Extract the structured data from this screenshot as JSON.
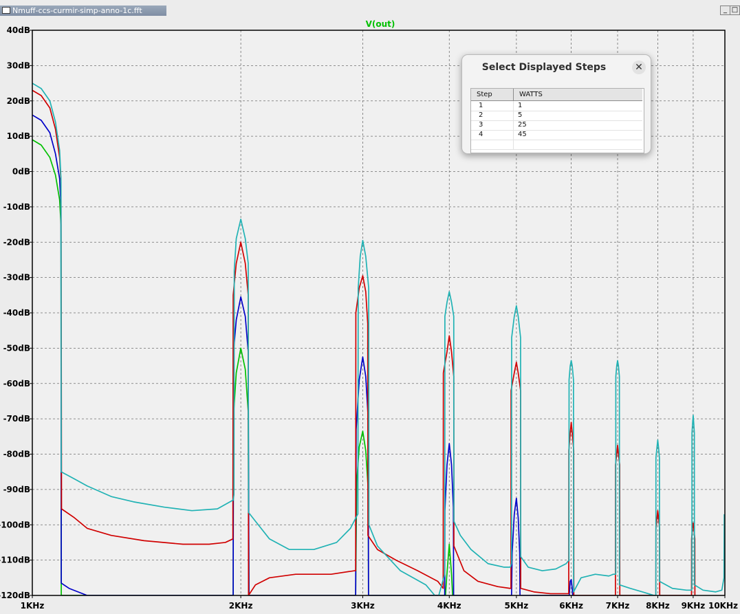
{
  "window": {
    "title": "Nmuff-ccs-curmir-simp-anno-1c.fft",
    "minimize_label": "_",
    "maximize_label": "□"
  },
  "colors": {
    "background": "#f0f0f0",
    "grid": "#6e6e6e",
    "frame": "#000000",
    "trace_title": "#00c000"
  },
  "chart_data": {
    "type": "line",
    "title": "V(out)",
    "x_scale": "log",
    "xlim": [
      1000,
      10000
    ],
    "ylim": [
      -120,
      40
    ],
    "grid": true,
    "y_ticks": [
      40,
      30,
      20,
      10,
      0,
      -10,
      -20,
      -30,
      -40,
      -50,
      -60,
      -70,
      -80,
      -90,
      -100,
      -110,
      -120
    ],
    "y_tick_labels": [
      "40dB",
      "30dB",
      "20dB",
      "10dB",
      "0dB",
      "-10dB",
      "-20dB",
      "-30dB",
      "-40dB",
      "-50dB",
      "-60dB",
      "-70dB",
      "-80dB",
      "-90dB",
      "-100dB",
      "-110dB",
      "-120dB"
    ],
    "x_ticks": [
      1000,
      2000,
      3000,
      4000,
      5000,
      6000,
      7000,
      8000,
      9000,
      10000
    ],
    "x_tick_labels": [
      "1KHz",
      "2KHz",
      "3KHz",
      "4KHz",
      "5KHz",
      "6KHz",
      "7KHz",
      "8KHz",
      "9KHz",
      "10KHz"
    ],
    "series": [
      {
        "color": "#00c000",
        "points": [
          [
            1000,
            9
          ],
          [
            1030,
            7.5
          ],
          [
            1060,
            4
          ],
          [
            1080,
            -1
          ],
          [
            1095,
            -8
          ],
          [
            1100,
            -15
          ],
          [
            1101,
            -120
          ],
          [
            1950,
            -120
          ],
          [
            1952,
            -69
          ],
          [
            1970,
            -57
          ],
          [
            2000,
            -50
          ],
          [
            2030,
            -56
          ],
          [
            2050,
            -68
          ],
          [
            2055,
            -120
          ],
          [
            2930,
            -120
          ],
          [
            2940,
            -88
          ],
          [
            2965,
            -78
          ],
          [
            3000,
            -73.5
          ],
          [
            3030,
            -79
          ],
          [
            3055,
            -90
          ],
          [
            3058,
            -120
          ],
          [
            3950,
            -120
          ],
          [
            3965,
            -115
          ],
          [
            4000,
            -105.5
          ],
          [
            4030,
            -114
          ],
          [
            4045,
            -120
          ]
        ]
      },
      {
        "color": "#0000c8",
        "points": [
          [
            1000,
            16
          ],
          [
            1030,
            14.5
          ],
          [
            1060,
            11
          ],
          [
            1080,
            5
          ],
          [
            1095,
            -2
          ],
          [
            1100,
            -10
          ],
          [
            1101,
            -116.5
          ],
          [
            1130,
            -118
          ],
          [
            1200,
            -120
          ],
          [
            1950,
            -120
          ],
          [
            1952,
            -51
          ],
          [
            1970,
            -42
          ],
          [
            2000,
            -35.5
          ],
          [
            2030,
            -41
          ],
          [
            2050,
            -51
          ],
          [
            2055,
            -120
          ],
          [
            2930,
            -120
          ],
          [
            2935,
            -73
          ],
          [
            2965,
            -59
          ],
          [
            3000,
            -52.5
          ],
          [
            3030,
            -58
          ],
          [
            3055,
            -70
          ],
          [
            3058,
            -120
          ],
          [
            3940,
            -120
          ],
          [
            3942,
            -96
          ],
          [
            3970,
            -83
          ],
          [
            4000,
            -77
          ],
          [
            4030,
            -83
          ],
          [
            4055,
            -95
          ],
          [
            4058,
            -120
          ],
          [
            4920,
            -120
          ],
          [
            4930,
            -108
          ],
          [
            4965,
            -97
          ],
          [
            5000,
            -92.5
          ],
          [
            5030,
            -98
          ],
          [
            5055,
            -108
          ],
          [
            5060,
            -120
          ],
          [
            5960,
            -120
          ],
          [
            5980,
            -116
          ],
          [
            6000,
            -115.5
          ],
          [
            6020,
            -118
          ],
          [
            6030,
            -120
          ]
        ]
      },
      {
        "color": "#d00000",
        "points": [
          [
            1000,
            23
          ],
          [
            1030,
            21.5
          ],
          [
            1060,
            18
          ],
          [
            1080,
            12
          ],
          [
            1095,
            4
          ],
          [
            1100,
            -3
          ],
          [
            1101,
            -43
          ],
          [
            1102,
            -95.5
          ],
          [
            1150,
            -98
          ],
          [
            1200,
            -101
          ],
          [
            1300,
            -103
          ],
          [
            1450,
            -104.5
          ],
          [
            1650,
            -105.5
          ],
          [
            1800,
            -105.5
          ],
          [
            1900,
            -105
          ],
          [
            1948,
            -104
          ],
          [
            1950,
            -35
          ],
          [
            1970,
            -26
          ],
          [
            2000,
            -20
          ],
          [
            2030,
            -26
          ],
          [
            2050,
            -35
          ],
          [
            2052,
            -120
          ],
          [
            2100,
            -117
          ],
          [
            2200,
            -115
          ],
          [
            2400,
            -114
          ],
          [
            2700,
            -114
          ],
          [
            2920,
            -113
          ],
          [
            2930,
            -113
          ],
          [
            2932,
            -40
          ],
          [
            2965,
            -33
          ],
          [
            3000,
            -29.5
          ],
          [
            3030,
            -34
          ],
          [
            3050,
            -43
          ],
          [
            3052,
            -103
          ],
          [
            3150,
            -107
          ],
          [
            3350,
            -110
          ],
          [
            3600,
            -113
          ],
          [
            3850,
            -116
          ],
          [
            3920,
            -118
          ],
          [
            3922,
            -57
          ],
          [
            3970,
            -51
          ],
          [
            4000,
            -46.5
          ],
          [
            4030,
            -51
          ],
          [
            4060,
            -58
          ],
          [
            4062,
            -106
          ],
          [
            4200,
            -113
          ],
          [
            4400,
            -116
          ],
          [
            4700,
            -117.5
          ],
          [
            4900,
            -118
          ],
          [
            4910,
            -118
          ],
          [
            4912,
            -62
          ],
          [
            4965,
            -57
          ],
          [
            5000,
            -54
          ],
          [
            5030,
            -57
          ],
          [
            5070,
            -62
          ],
          [
            5072,
            -118
          ],
          [
            5300,
            -119
          ],
          [
            5600,
            -119.5
          ],
          [
            5900,
            -119.5
          ],
          [
            5950,
            -119.5
          ],
          [
            5952,
            -79
          ],
          [
            5980,
            -74
          ],
          [
            6000,
            -71
          ],
          [
            6020,
            -74
          ],
          [
            6050,
            -79
          ],
          [
            6052,
            -120
          ],
          [
            6950,
            -120
          ],
          [
            6952,
            -83
          ],
          [
            6980,
            -80
          ],
          [
            7000,
            -77.5
          ],
          [
            7020,
            -80
          ],
          [
            7050,
            -83
          ],
          [
            7052,
            -120
          ],
          [
            7950,
            -120
          ],
          [
            7952,
            -101
          ],
          [
            7980,
            -98
          ],
          [
            8000,
            -96
          ],
          [
            8020,
            -98
          ],
          [
            8050,
            -101
          ],
          [
            8052,
            -120
          ],
          [
            8950,
            -120
          ],
          [
            8952,
            -104
          ],
          [
            8980,
            -101
          ],
          [
            9000,
            -99.5
          ],
          [
            9020,
            -101
          ],
          [
            9050,
            -104
          ],
          [
            9052,
            -120
          ]
        ]
      },
      {
        "color": "#20b2b4",
        "points": [
          [
            1000,
            25
          ],
          [
            1030,
            23.5
          ],
          [
            1060,
            20
          ],
          [
            1080,
            14
          ],
          [
            1095,
            6
          ],
          [
            1100,
            -2
          ],
          [
            1101,
            -85
          ],
          [
            1150,
            -87
          ],
          [
            1200,
            -89
          ],
          [
            1300,
            -92
          ],
          [
            1400,
            -93.5
          ],
          [
            1550,
            -95
          ],
          [
            1700,
            -96
          ],
          [
            1850,
            -95.5
          ],
          [
            1950,
            -93
          ],
          [
            1955,
            -91.5
          ],
          [
            1957,
            -28
          ],
          [
            1970,
            -19
          ],
          [
            2000,
            -13.5
          ],
          [
            2030,
            -19
          ],
          [
            2050,
            -26
          ],
          [
            2052,
            -96.5
          ],
          [
            2100,
            -99
          ],
          [
            2200,
            -104
          ],
          [
            2350,
            -107
          ],
          [
            2550,
            -107
          ],
          [
            2750,
            -105
          ],
          [
            2880,
            -101
          ],
          [
            2950,
            -97
          ],
          [
            2952,
            -97
          ],
          [
            2955,
            -33
          ],
          [
            2975,
            -24
          ],
          [
            3000,
            -19.5
          ],
          [
            3030,
            -24
          ],
          [
            3060,
            -33
          ],
          [
            3062,
            -100
          ],
          [
            3150,
            -106
          ],
          [
            3400,
            -113
          ],
          [
            3700,
            -117
          ],
          [
            3850,
            -121
          ],
          [
            3940,
            -114
          ],
          [
            3942,
            -41
          ],
          [
            3970,
            -37
          ],
          [
            4000,
            -34
          ],
          [
            4030,
            -37
          ],
          [
            4060,
            -41
          ],
          [
            4062,
            -99
          ],
          [
            4150,
            -103
          ],
          [
            4300,
            -107
          ],
          [
            4550,
            -111
          ],
          [
            4800,
            -112
          ],
          [
            4900,
            -112
          ],
          [
            4920,
            -111
          ],
          [
            4922,
            -47
          ],
          [
            4965,
            -41
          ],
          [
            5000,
            -38
          ],
          [
            5030,
            -41
          ],
          [
            5070,
            -47
          ],
          [
            5072,
            -109
          ],
          [
            5200,
            -112
          ],
          [
            5450,
            -113
          ],
          [
            5700,
            -112.5
          ],
          [
            5900,
            -111
          ],
          [
            5955,
            -110
          ],
          [
            5957,
            -59
          ],
          [
            5980,
            -55
          ],
          [
            6000,
            -53.5
          ],
          [
            6020,
            -55
          ],
          [
            6045,
            -59
          ],
          [
            6047,
            -119
          ],
          [
            6200,
            -115
          ],
          [
            6500,
            -114
          ],
          [
            6800,
            -114.5
          ],
          [
            6900,
            -114
          ],
          [
            6957,
            -114
          ],
          [
            6959,
            -58
          ],
          [
            6980,
            -55
          ],
          [
            7000,
            -53.5
          ],
          [
            7020,
            -55
          ],
          [
            7042,
            -58
          ],
          [
            7044,
            -117
          ],
          [
            7300,
            -118
          ],
          [
            7600,
            -119
          ],
          [
            7900,
            -120
          ],
          [
            7950,
            -120
          ],
          [
            7952,
            -81
          ],
          [
            7980,
            -78
          ],
          [
            8000,
            -76
          ],
          [
            8020,
            -78
          ],
          [
            8045,
            -81
          ],
          [
            8047,
            -116
          ],
          [
            8400,
            -118
          ],
          [
            8800,
            -118.5
          ],
          [
            8950,
            -118.5
          ],
          [
            8962,
            -118
          ],
          [
            8964,
            -74
          ],
          [
            8985,
            -71
          ],
          [
            9000,
            -69
          ],
          [
            9015,
            -71
          ],
          [
            9035,
            -74
          ],
          [
            9037,
            -117
          ],
          [
            9300,
            -118.5
          ],
          [
            9700,
            -119
          ],
          [
            9900,
            -118.5
          ],
          [
            9970,
            -115
          ],
          [
            9980,
            -97
          ]
        ]
      }
    ]
  },
  "dialog": {
    "title": "Select Displayed Steps",
    "close_label": "✕",
    "columns": [
      "Step",
      "WATTS"
    ],
    "rows": [
      [
        "1",
        "1"
      ],
      [
        "2",
        "5"
      ],
      [
        "3",
        "25"
      ],
      [
        "4",
        "45"
      ],
      [
        "",
        ""
      ]
    ]
  }
}
